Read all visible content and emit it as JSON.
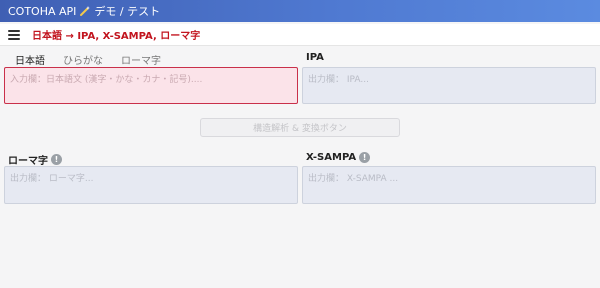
{
  "header": {
    "app_title": "COTOHA API",
    "app_subtitle": "デモ / テスト",
    "logo_icon": "sparkle-icon"
  },
  "subheader": {
    "menu_icon": "hamburger-icon",
    "title": "日本語 → IPA, X-SAMPA, ローマ字"
  },
  "tabs": [
    {
      "label": "日本語",
      "active": true
    },
    {
      "label": "ひらがな",
      "active": false
    },
    {
      "label": "ローマ字",
      "active": false
    }
  ],
  "input": {
    "value": "",
    "placeholder": "入力欄：日本語文 (漢字・かな・カナ・記号)...."
  },
  "ipa": {
    "label": "IPA",
    "value": "",
    "placeholder": "出力欄： IPA..."
  },
  "convert_button": {
    "label": "構造解析 & 変換ボタン",
    "disabled": true
  },
  "romaji": {
    "label": "ローマ字",
    "info_icon": "info-icon",
    "value": "",
    "placeholder": "出力欄： ローマ字..."
  },
  "xsampa": {
    "label": "X-SAMPA",
    "info_icon": "info-icon",
    "value": "",
    "placeholder": "出力欄： X-SAMPA ..."
  },
  "colors": {
    "accent": "#c2151f",
    "header_bg": "#4f79d1",
    "input_bg": "#fbe3e9",
    "output_bg": "#e6e9f2"
  }
}
